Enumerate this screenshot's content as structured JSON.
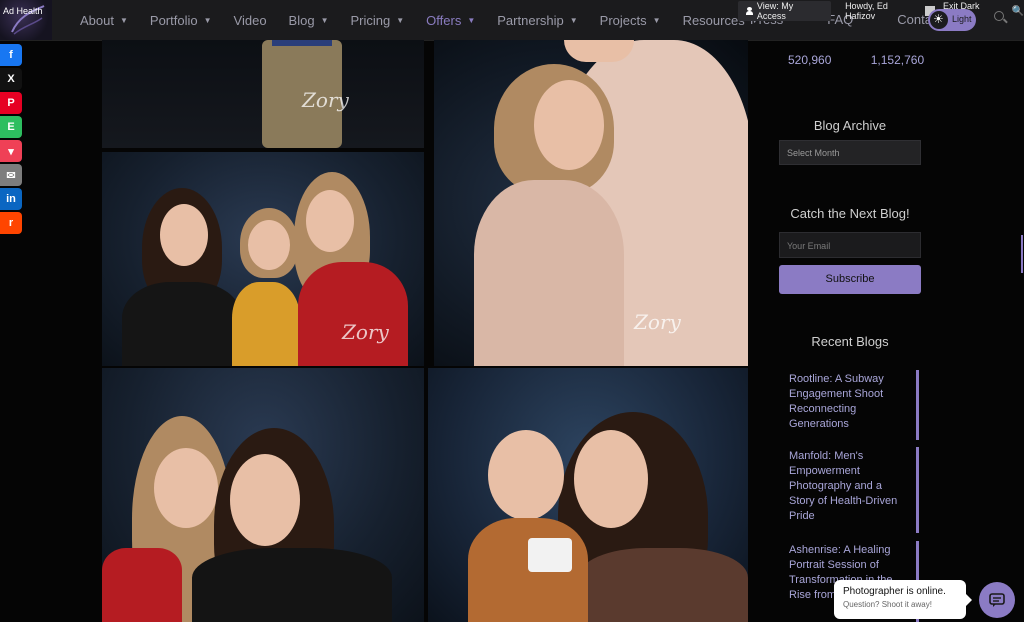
{
  "brand": {
    "adhealth_label": "Ad Health"
  },
  "nav": {
    "items": [
      {
        "label": "About",
        "caret": true
      },
      {
        "label": "Portfolio",
        "caret": true
      },
      {
        "label": "Video",
        "caret": false
      },
      {
        "label": "Blog",
        "caret": true
      },
      {
        "label": "Pricing",
        "caret": true
      },
      {
        "label": "Offers",
        "caret": true
      },
      {
        "label": "Partnership",
        "caret": true
      },
      {
        "label": "Projects",
        "caret": true
      },
      {
        "label": "Resources",
        "caret": true
      }
    ],
    "right_items": [
      "Press",
      "FAQ",
      "Contact"
    ],
    "theme_toggle_label": "Light"
  },
  "admin_bar": {
    "view_access": "View: My Access",
    "howdy": "Howdy, Ed Hafizov",
    "dark_mode": "Exit Dark Mode"
  },
  "share_bar": [
    {
      "name": "facebook",
      "glyph": "f",
      "color": "#1877f2"
    },
    {
      "name": "x",
      "glyph": "X",
      "color": "#111111"
    },
    {
      "name": "pinterest",
      "glyph": "P",
      "color": "#e60023"
    },
    {
      "name": "evernote",
      "glyph": "E",
      "color": "#2dbe60"
    },
    {
      "name": "pocket",
      "glyph": "▾",
      "color": "#ef4056"
    },
    {
      "name": "email",
      "glyph": "✉",
      "color": "#7d7d7d"
    },
    {
      "name": "linkedin",
      "glyph": "in",
      "color": "#0a66c2"
    },
    {
      "name": "reddit",
      "glyph": "r",
      "color": "#ff4500"
    }
  ],
  "sidebar": {
    "stats": [
      "520,960",
      "1,152,760"
    ],
    "blog_archive_title": "Blog Archive",
    "select_month": "Select Month",
    "catch_title": "Catch the Next Blog!",
    "email_placeholder": "Your Email",
    "subscribe_label": "Subscribe",
    "recent_title": "Recent Blogs",
    "recent": [
      "Rootline: A Subway Engagement Shoot Reconnecting Generations",
      "Manfold: Men's Empowerment Photography and a Story of Health-Driven Pride",
      "Ashenrise: A Healing Portrait Session of Transformation in the Rise from"
    ]
  },
  "chat": {
    "title": "Photographer is online.",
    "subtitle": "Question? Shoot it away!"
  },
  "colors": {
    "accent": "#8b7bc4",
    "link": "#a9a6d9",
    "bg": "#050505"
  }
}
